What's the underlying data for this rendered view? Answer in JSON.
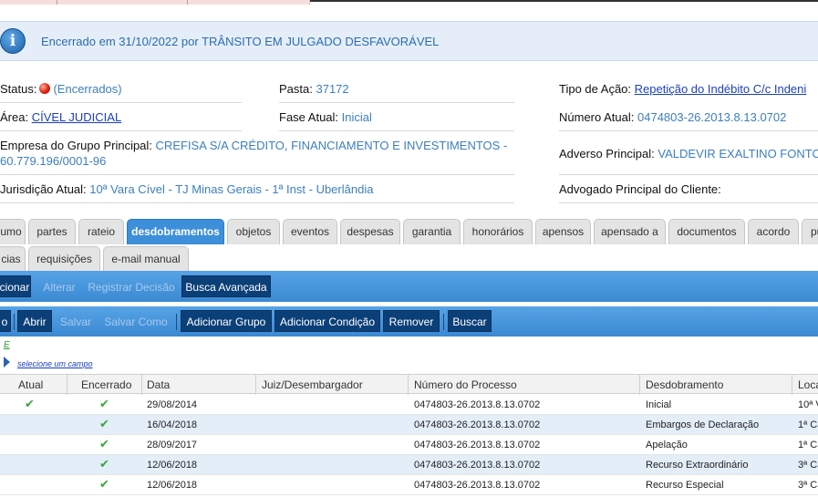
{
  "banner": {
    "text": "Encerrado em 31/10/2022 por TRÂNSITO EM JULGADO DESFAVORÁVEL"
  },
  "details": {
    "status_label": "Status:",
    "status_value": "(Encerrados)",
    "pasta_label": "Pasta:",
    "pasta_value": "37172",
    "tipo_acao_label": "Tipo de Ação:",
    "tipo_acao_value": "Repetição do Indébito C/c Indeni",
    "area_label": "Área:",
    "area_value": "CÍVEL JUDICIAL",
    "fase_label": "Fase Atual:",
    "fase_value": "Inicial",
    "numero_label": "Número Atual:",
    "numero_value": "0474803-26.2013.8.13.0702",
    "empresa_label": "Empresa do Grupo Principal:",
    "empresa_value_line1": "CREFISA S/A CRÉDITO, FINANCIAMENTO E INVESTIMENTOS -",
    "empresa_value_line2": "60.779.196/0001-96",
    "adverso_label": "Adverso Principal:",
    "adverso_value": "VALDEVIR EXALTINO FONTO",
    "jurisdicao_label": "Jurisdição Atual:",
    "jurisdicao_value": "10ª Vara Cível - TJ Minas Gerais - 1ª Inst - Uberlândia",
    "advogado_label": "Advogado Principal do Cliente:"
  },
  "tabs_row1": [
    "umo",
    "partes",
    "rateio",
    "desdobramentos",
    "objetos",
    "eventos",
    "despesas",
    "garantia",
    "honorários",
    "apensos",
    "apensado a",
    "documentos",
    "acordo",
    "pu"
  ],
  "tabs_row2": [
    "cias",
    "requisições",
    "e-mail manual"
  ],
  "active_tab": "desdobramentos",
  "toolbar1": {
    "adicionar": "cionar",
    "alterar": "Alterar",
    "registrar": "Registrar Decisão",
    "busca": "Busca Avançada"
  },
  "toolbar2": {
    "novo": "o",
    "abrir": "Abrir",
    "salvar": "Salvar",
    "salvar_como": "Salvar Como",
    "adicionar_grupo": "Adicionar Grupo",
    "adicionar_condicao": "Adicionar Condição",
    "remover": "Remover",
    "buscar": "Buscar"
  },
  "filter": {
    "e_mark": "E",
    "select_field": "selecione um campo"
  },
  "table": {
    "headers": {
      "atual": "Atual",
      "encerrado": "Encerrado",
      "data": "Data",
      "juiz": "Juiz/Desembargador",
      "numero": "Número do Processo",
      "desdobramento": "Desdobramento",
      "local": "Loca"
    },
    "rows": [
      {
        "atual": true,
        "encerrado": true,
        "data": "29/08/2014",
        "juiz": "",
        "numero": "0474803-26.2013.8.13.0702",
        "desdobramento": "Inicial",
        "local": "10ª V"
      },
      {
        "atual": false,
        "encerrado": true,
        "data": "16/04/2018",
        "juiz": "",
        "numero": "0474803-26.2013.8.13.0702",
        "desdobramento": "Embargos de Declaração",
        "local": "1ª Câ"
      },
      {
        "atual": false,
        "encerrado": true,
        "data": "28/09/2017",
        "juiz": "",
        "numero": "0474803-26.2013.8.13.0702",
        "desdobramento": "Apelação",
        "local": "1ª Câ"
      },
      {
        "atual": false,
        "encerrado": true,
        "data": "12/06/2018",
        "juiz": "",
        "numero": "0474803-26.2013.8.13.0702",
        "desdobramento": "Recurso Extraordinário",
        "local": "3ª Câ"
      },
      {
        "atual": false,
        "encerrado": true,
        "data": "12/06/2018",
        "juiz": "",
        "numero": "0474803-26.2013.8.13.0702",
        "desdobramento": "Recurso Especial",
        "local": "3ª Câ"
      }
    ]
  },
  "icons": {
    "info": "info-icon",
    "status": "status-red-dot-icon",
    "check": "check-icon",
    "expand": "expand-triangle-icon"
  },
  "colors": {
    "accent": "#3d8fd9",
    "button_dark": "#0b3f78",
    "link": "#1c3fbf",
    "value": "#3c7fc0",
    "row_alt": "#e3eef9"
  }
}
